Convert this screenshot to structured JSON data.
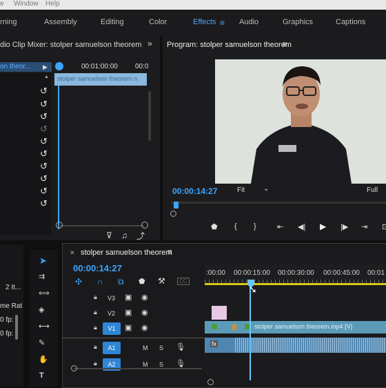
{
  "menubar": {
    "items": [
      "w",
      "Window",
      "Help"
    ]
  },
  "workspaces": {
    "tabs": [
      "rning",
      "Assembly",
      "Editing",
      "Color",
      "Effects",
      "Audio",
      "Graphics",
      "Captions"
    ],
    "active": "Effects",
    "menu_icon": "hamburger-icon"
  },
  "audio_mixer": {
    "title": "dio Clip Mixer: stolper samuelson theorem",
    "expand_icon": "double-chevron-right-icon"
  },
  "source_panel": {
    "clip_name": "on theor...",
    "timecode_a": "00:01:00:00",
    "timecode_b": "00:0",
    "clip_label": "stolper samuelson theorem n"
  },
  "program": {
    "title": "Program: stolper samuelson theorem",
    "timecode": "00:00:14:27",
    "zoom": "Fit",
    "quality": "Full"
  },
  "left_bottom": {
    "item_count": "2 It...",
    "frame_rate_label": "me Rat",
    "fps1": "0 fp:",
    "fps2": "0 fp:"
  },
  "timeline": {
    "title": "stolper samuelson theorem",
    "timecode": "00:00:14:27",
    "ruler": [
      ":00:00",
      "00:00:15:00",
      "00:00:30:00",
      "00:00:45:00",
      "00:01"
    ],
    "tracks": {
      "video": [
        "V3",
        "V2",
        "V1"
      ],
      "audio": [
        "A1",
        "A2"
      ]
    },
    "target_v": "V1",
    "target_a": [
      "A1",
      "A2"
    ],
    "clip_label": "stolper samuelson theorem.mp4 [V]",
    "fx": "fx",
    "mute": "M",
    "solo": "S",
    "cc": "CC"
  },
  "colors": {
    "accent": "#3aa6ff",
    "target": "#2f86d6",
    "clip_video": "#5b9bb8",
    "clip_audio": "#4f86b0",
    "playhead": "#66c7ff"
  }
}
